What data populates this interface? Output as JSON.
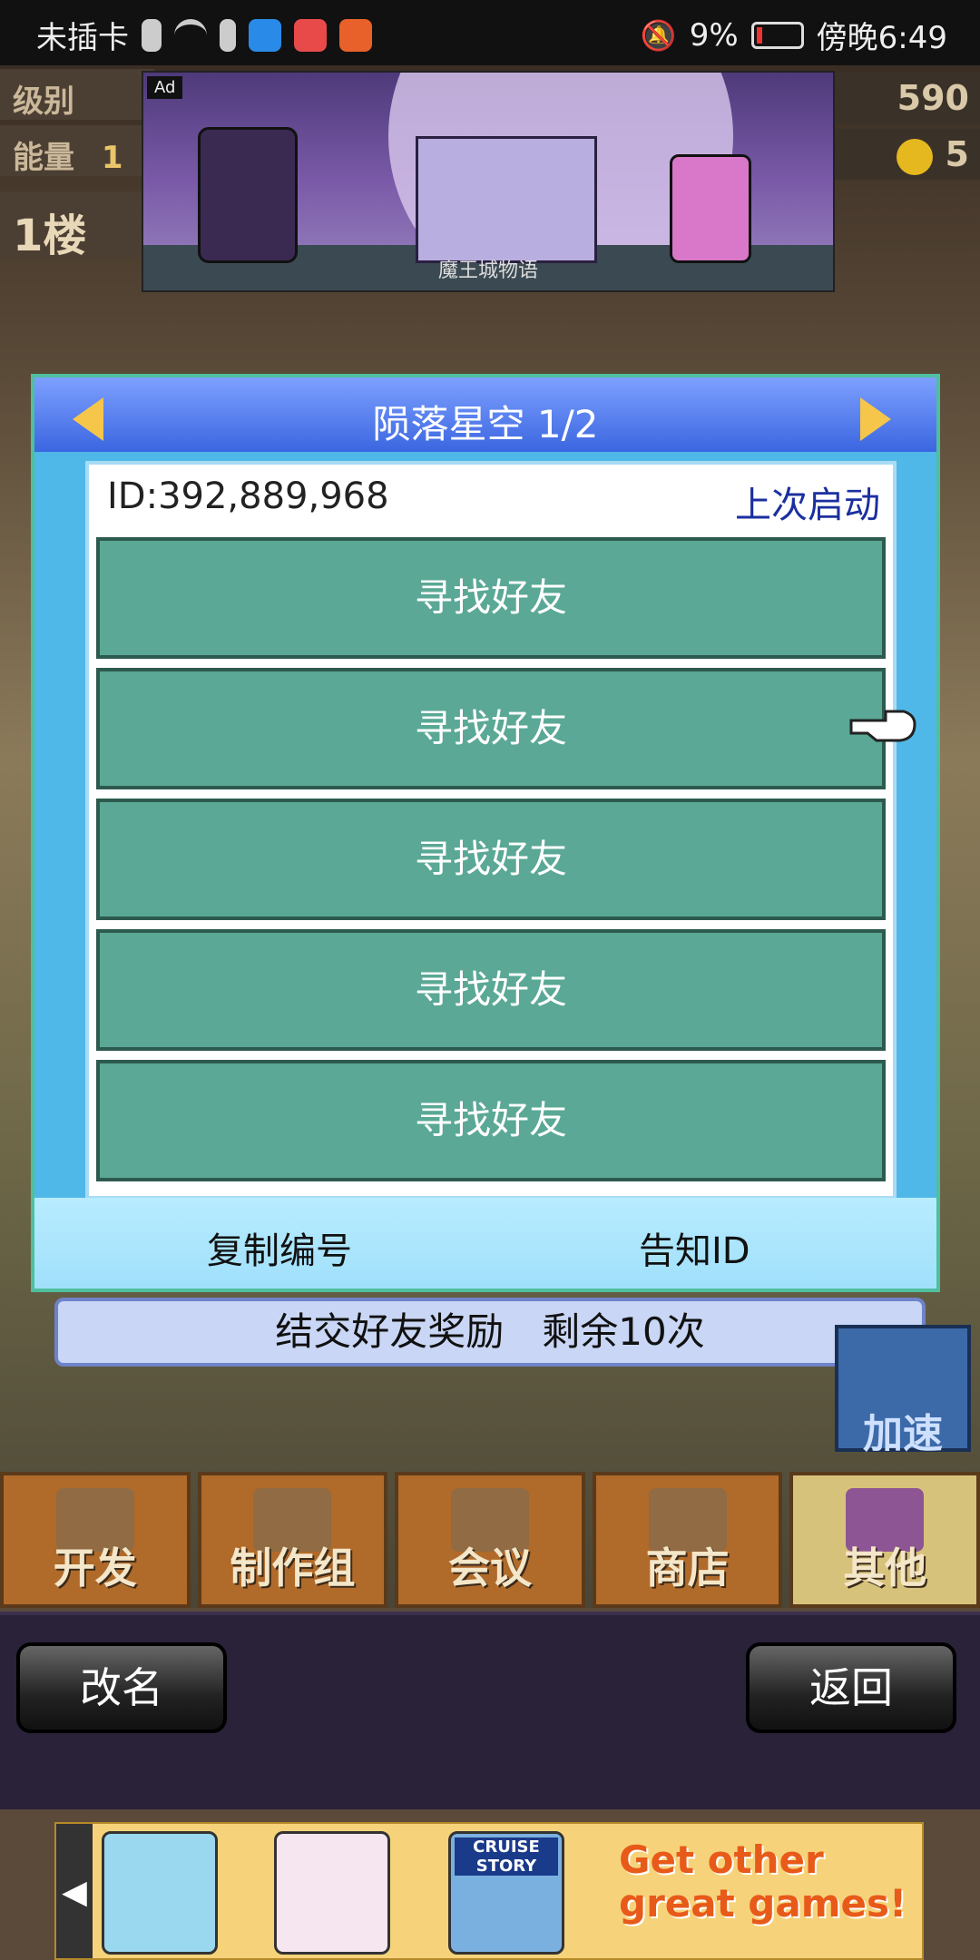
{
  "status_bar": {
    "carrier": "未插卡",
    "battery": "9%",
    "time": "傍晚6:49"
  },
  "hud": {
    "level_label": "级别",
    "energy_label": "能量",
    "energy_value": "1",
    "floor_label": "1楼",
    "points": "590",
    "coins": "5"
  },
  "top_ad": {
    "tag": "Ad",
    "caption": "魔王城物语"
  },
  "dialog": {
    "title": "陨落星空 1/2",
    "id_text": "ID:392,889,968",
    "last_launch": "上次启动",
    "friend_rows": [
      "寻找好友",
      "寻找好友",
      "寻找好友",
      "寻找好友",
      "寻找好友"
    ],
    "copy_label": "复制编号",
    "notify_label": "告知ID"
  },
  "reward_bar": "结交好友奖励　剩余10次",
  "speed_button": "加速",
  "tabs": [
    {
      "label": "开发",
      "icon": "computer-icon"
    },
    {
      "label": "制作组",
      "icon": "team-icon"
    },
    {
      "label": "会议",
      "icon": "chat-bubbles-icon"
    },
    {
      "label": "商店",
      "icon": "shop-icon"
    },
    {
      "label": "其他",
      "icon": "music-note-icon"
    }
  ],
  "bottom_nav": {
    "rename_label": "改名",
    "back_label": "返回"
  },
  "bottom_ad": {
    "thumb3_title": "CRUISE STORY",
    "text": "Get other great games!"
  },
  "colors": {
    "dialog_bg": "#4fb8e8",
    "row_bg": "#5aa895",
    "header_blue": "#3b66e0",
    "arrow_gold": "#f5c64a"
  }
}
